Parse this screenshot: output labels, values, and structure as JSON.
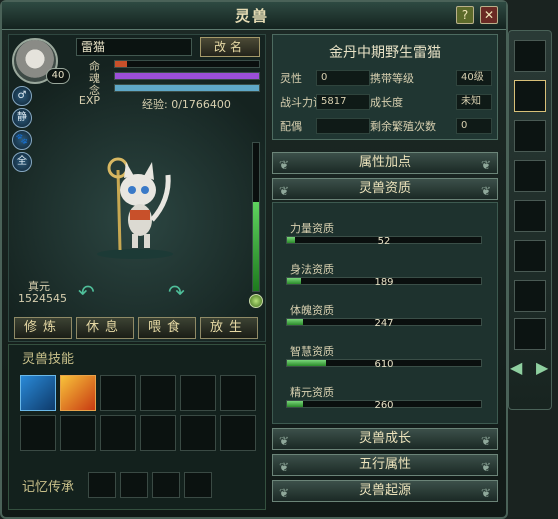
{
  "window": {
    "title": "灵兽",
    "help_label": "?",
    "close_label": "✕"
  },
  "pet": {
    "name": "雷猫",
    "level": "40",
    "rename_label": "改名",
    "stats": [
      {
        "label": "命",
        "fill": 0.08,
        "color": "#c8502a"
      },
      {
        "label": "魂",
        "fill": 1.0,
        "color": "#9b4fd8"
      },
      {
        "label": "念",
        "fill": 1.0,
        "color": "#5fa8c8"
      },
      {
        "label": "EXP",
        "fill": 0.0,
        "color": "#58b838"
      }
    ],
    "exp_text": "经验: 0/1766400",
    "side_icons": [
      "♂",
      "静",
      "🐾",
      "全"
    ],
    "zhenyuan_label": "真元",
    "zhenyuan_value": "1524545",
    "vitality_fill": 0.6
  },
  "actions": [
    "修炼",
    "休息",
    "喂食",
    "放生"
  ],
  "skills": {
    "title": "灵兽技能",
    "memory_label": "记忆传承"
  },
  "info": {
    "title": "金丹中期野生雷猫",
    "rows": [
      {
        "k1": "灵性",
        "v1": "0",
        "k2": "携带等级",
        "v2": "40级"
      },
      {
        "k1": "战斗力评价",
        "v1": "5817",
        "k2": "成长度",
        "v2": "未知"
      },
      {
        "k1": "配偶",
        "v1": "",
        "k2": "剩余繁殖次数",
        "v2": "0"
      }
    ]
  },
  "sections": {
    "attr_points": "属性加点",
    "aptitude": "灵兽资质",
    "growth": "灵兽成长",
    "wuxing": "五行属性",
    "origin": "灵兽起源"
  },
  "aptitudes": [
    {
      "label": "力量资质",
      "value": "52",
      "fill": 0.04
    },
    {
      "label": "身法资质",
      "value": "189",
      "fill": 0.07
    },
    {
      "label": "体魄资质",
      "value": "247",
      "fill": 0.08
    },
    {
      "label": "智慧资质",
      "value": "610",
      "fill": 0.2
    },
    {
      "label": "精元资质",
      "value": "260",
      "fill": 0.08
    }
  ]
}
